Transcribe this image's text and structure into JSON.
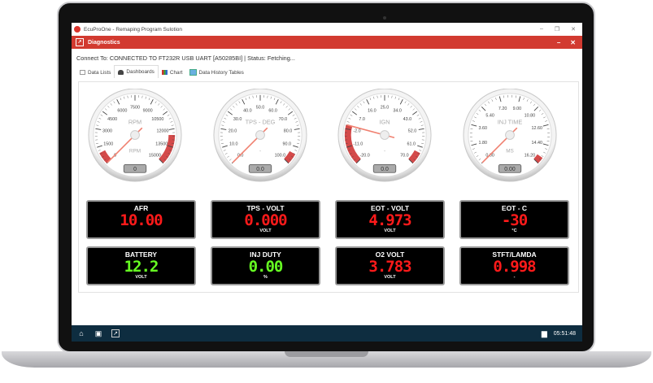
{
  "window": {
    "title": "EcuProOne - Remaping Program Sulotion",
    "minimize": "–",
    "restore": "❐",
    "close": "✕"
  },
  "header": {
    "title": "Diagnostics",
    "minimize": "–",
    "close": "✕"
  },
  "connection": {
    "text": "Connect To: CONNECTED TO FT232R USB UART [A50285BI] | Status: Fetching..."
  },
  "tabs": [
    {
      "label": "Data Lists"
    },
    {
      "label": "Dashboards",
      "active": true
    },
    {
      "label": "Chart"
    },
    {
      "label": "Data History Tables"
    }
  ],
  "gauges": [
    {
      "label": "RPM",
      "unit": "RPM",
      "min": 0,
      "max": 15000,
      "value": 0,
      "display": "0",
      "ticks": [
        "0",
        "1500",
        "3000",
        "4500",
        "6000",
        "7500",
        "9000",
        "10500",
        "12000",
        "13500",
        "15000"
      ],
      "red_zones": [
        [
          0,
          1000
        ],
        [
          12500,
          15000
        ]
      ]
    },
    {
      "label": "TPS - DEG",
      "unit": "-",
      "min": 0,
      "max": 100,
      "value": 0,
      "display": "0.0",
      "ticks": [
        "0.0",
        "10.0",
        "20.0",
        "30.0",
        "40.0",
        "50.0",
        "60.0",
        "70.0",
        "80.0",
        "90.0",
        "100.0"
      ],
      "red_zones": [
        [
          94,
          100
        ]
      ]
    },
    {
      "label": "IGN",
      "unit": "-",
      "min": -20,
      "max": 70,
      "value": 0,
      "display": "0.0",
      "ticks": [
        "-20.0",
        "-11.0",
        "-2.0",
        "7.0",
        "16.0",
        "25.0",
        "34.0",
        "43.0",
        "52.0",
        "61.0",
        "70.0"
      ],
      "red_zones": [
        [
          -20,
          0
        ],
        [
          64,
          70
        ]
      ]
    },
    {
      "label": "INJ TIME",
      "unit": "MS",
      "min": 0,
      "max": 16.2,
      "value": 0,
      "display": "0.00",
      "ticks": [
        "0.00",
        "1.80",
        "3.60",
        "5.40",
        "7.20",
        "9.00",
        "10.80",
        "12.60",
        "14.40",
        "16.20"
      ],
      "red_zones": [
        [
          15.6,
          16.2
        ]
      ]
    }
  ],
  "digitals": [
    {
      "label": "AFR",
      "value": "10.00",
      "unit": "",
      "color": "#ff1a1a"
    },
    {
      "label": "TPS - VOLT",
      "value": "0.000",
      "unit": "VOLT",
      "color": "#ff1a1a"
    },
    {
      "label": "EOT - VOLT",
      "value": "4.973",
      "unit": "VOLT",
      "color": "#ff1a1a"
    },
    {
      "label": "EOT - C",
      "value": "-30",
      "unit": "°C",
      "color": "#ff1a1a"
    },
    {
      "label": "BATTERY",
      "value": "12.2",
      "unit": "VOLT",
      "color": "#66ff22"
    },
    {
      "label": "INJ DUTY",
      "value": "0.00",
      "unit": "%",
      "color": "#66ff22"
    },
    {
      "label": "O2 VOLT",
      "value": "3.783",
      "unit": "VOLT",
      "color": "#ff1a1a"
    },
    {
      "label": "STFT/LAMDA",
      "value": "0.998",
      "unit": "-",
      "color": "#ff1a1a"
    }
  ],
  "taskbar": {
    "icons": [
      "home-icon",
      "window-icon",
      "chart-icon"
    ],
    "clock": "05:51:48"
  },
  "colors": {
    "accent": "#d23a30",
    "taskbar": "#0e2d40",
    "needle": "#f08070"
  }
}
